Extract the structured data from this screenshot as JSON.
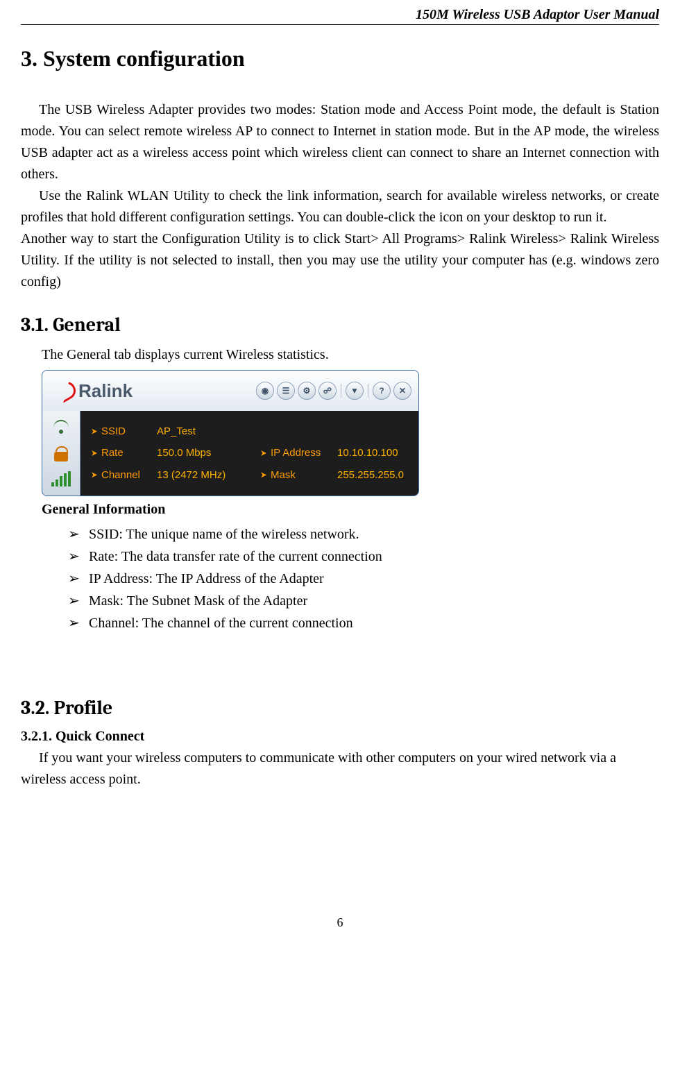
{
  "header": {
    "title": "150M Wireless USB Adaptor User Manual"
  },
  "h1": "3. System configuration",
  "para1": "The USB Wireless Adapter provides two modes: Station mode and Access Point mode, the default is Station mode. You can select remote wireless AP to connect to Internet in station mode. But in the AP mode, the wireless USB adapter act as a wireless access point which wireless client can connect to share an Internet connection with others.",
  "para2": "Use the Ralink WLAN Utility to check the link information, search for available wireless networks, or create profiles that hold different configuration settings. You can double-click the icon on your desktop to run it.",
  "para3": "Another way to start the Configuration Utility is to click Start> All Programs> Ralink Wireless> Ralink Wireless Utility. If the utility is not selected to install, then you may use the utility your computer has (e.g. windows zero config)",
  "sec31": {
    "title": "3.1. General",
    "intro": "The General tab displays current Wireless statistics.",
    "info_heading": "General Information",
    "bullets": [
      "SSID: The unique name of the wireless network.",
      "Rate: The data transfer rate of the current connection",
      "IP Address: The IP Address of the Adapter",
      "Mask: The Subnet Mask of the Adapter",
      "Channel: The channel of the current connection"
    ]
  },
  "ralink": {
    "logo": "Ralink",
    "toolbar_icons": [
      "rss",
      "checklist",
      "settings",
      "link",
      "help",
      "close"
    ],
    "fields": {
      "ssid_label": "SSID",
      "ssid_value": "AP_Test",
      "rate_label": "Rate",
      "rate_value": "150.0 Mbps",
      "channel_label": "Channel",
      "channel_value": "13 (2472 MHz)",
      "ip_label": "IP Address",
      "ip_value": "10.10.10.100",
      "mask_label": "Mask",
      "mask_value": "255.255.255.0"
    }
  },
  "sec32": {
    "title": "3.2. Profile",
    "sub_title": "3.2.1. Quick Connect",
    "body": "If you want your wireless computers to communicate with other computers on your wired network via a wireless access point."
  },
  "page_number": "6",
  "glyphs": {
    "bullet": "➢",
    "rss": "◉",
    "checklist": "☰",
    "settings": "⚙",
    "link": "☍",
    "help": "?",
    "close": "✕",
    "down": "▼"
  }
}
